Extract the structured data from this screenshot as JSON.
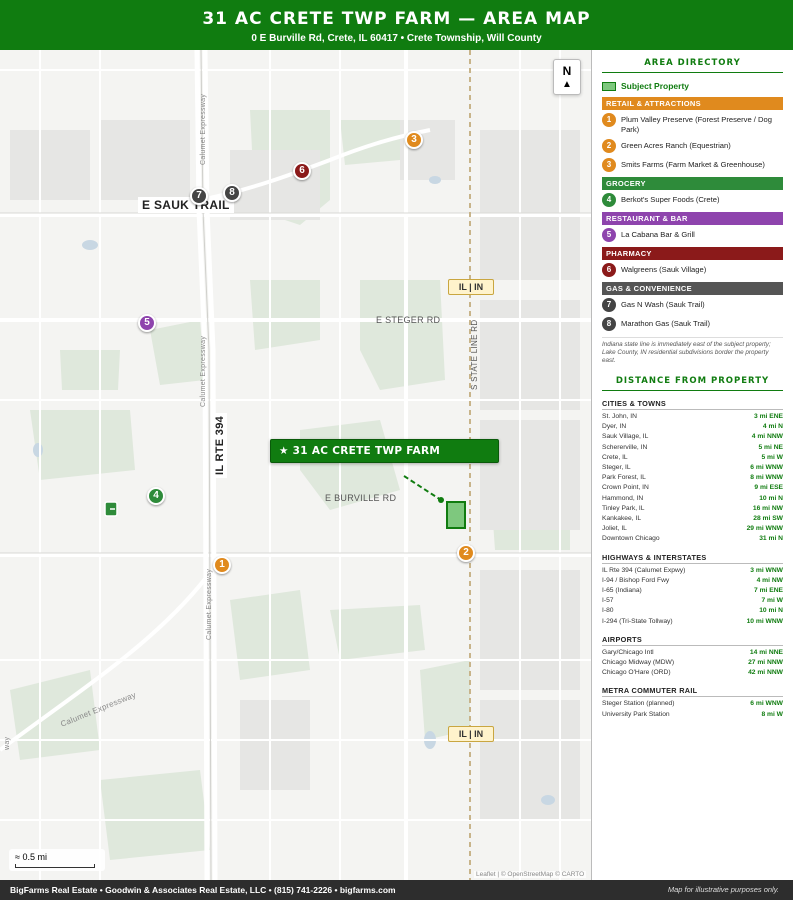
{
  "header": {
    "title": "31 AC CRETE TWP FARM — AREA MAP",
    "subtitle": "0 E Burville Rd, Crete, IL 60417 • Crete Township, Will County"
  },
  "map": {
    "compass": "N",
    "farm_label": "★ 31 AC CRETE TWP FARM",
    "road_labels": {
      "sauk_trail": "E SAUK TRAIL",
      "steger_rd": "E STEGER RD",
      "burville_rd": "E BURVILLE RD",
      "il_rte_394": "IL RTE 394",
      "state_line_rd": "S STATE LINE RD",
      "calumet_expy_1": "Calumet Expressway",
      "calumet_expy_2": "Calumet Expressway",
      "calumet_expy_3": "Calumet Expressway",
      "calumet_expy_diag": "Calumet Expressway",
      "expy_edge": "way"
    },
    "state_line_badge": "IL | IN",
    "markers": {
      "m1": "1",
      "m2": "2",
      "m3": "3",
      "m4": "4",
      "m5": "5",
      "m6": "6",
      "m7": "7",
      "m8": "8"
    },
    "scale": "≈ 0.5 mi",
    "attribution": "Leaflet | © OpenStreetMap © CARTO"
  },
  "sidebar": {
    "directory_title": "AREA DIRECTORY",
    "subject_label": "Subject Property",
    "categories": {
      "retail": "RETAIL & ATTRACTIONS",
      "grocery": "GROCERY",
      "restaurant": "RESTAURANT & BAR",
      "pharmacy": "PHARMACY",
      "gas": "GAS & CONVENIENCE"
    },
    "entries": {
      "e1": {
        "num": "1",
        "name": "Plum Valley Preserve (Forest Preserve / Dog Park)"
      },
      "e2": {
        "num": "2",
        "name": "Green Acres Ranch (Equestrian)"
      },
      "e3": {
        "num": "3",
        "name": "Smits Farms (Farm Market & Greenhouse)"
      },
      "e4": {
        "num": "4",
        "name": "Berkot's Super Foods (Crete)"
      },
      "e5": {
        "num": "5",
        "name": "La Cabana Bar & Grill"
      },
      "e6": {
        "num": "6",
        "name": "Walgreens (Sauk Village)"
      },
      "e7": {
        "num": "7",
        "name": "Gas N Wash (Sauk Trail)"
      },
      "e8": {
        "num": "8",
        "name": "Marathon Gas (Sauk Trail)"
      }
    },
    "note": "Indiana state line is immediately east of the subject property; Lake County, IN residential subdivisions border the property east.",
    "distance_title": "DISTANCE FROM PROPERTY",
    "groups": {
      "cities": {
        "title": "CITIES & TOWNS",
        "rows": [
          {
            "name": "St. John, IN",
            "dist": "3 mi ENE"
          },
          {
            "name": "Dyer, IN",
            "dist": "4 mi N"
          },
          {
            "name": "Sauk Village, IL",
            "dist": "4 mi NNW"
          },
          {
            "name": "Schererville, IN",
            "dist": "5 mi NE"
          },
          {
            "name": "Crete, IL",
            "dist": "5 mi W"
          },
          {
            "name": "Steger, IL",
            "dist": "6 mi WNW"
          },
          {
            "name": "Park Forest, IL",
            "dist": "8 mi WNW"
          },
          {
            "name": "Crown Point, IN",
            "dist": "9 mi ESE"
          },
          {
            "name": "Hammond, IN",
            "dist": "10 mi N"
          },
          {
            "name": "Tinley Park, IL",
            "dist": "16 mi NW"
          },
          {
            "name": "Kankakee, IL",
            "dist": "28 mi SW"
          },
          {
            "name": "Joliet, IL",
            "dist": "29 mi WNW"
          },
          {
            "name": "Downtown Chicago",
            "dist": "31 mi N"
          }
        ]
      },
      "highways": {
        "title": "HIGHWAYS & INTERSTATES",
        "rows": [
          {
            "name": "IL Rte 394 (Calumet Expwy)",
            "dist": "3 mi WNW"
          },
          {
            "name": "I-94 / Bishop Ford Fwy",
            "dist": "4 mi NW"
          },
          {
            "name": "I-65 (Indiana)",
            "dist": "7 mi ENE"
          },
          {
            "name": "I-57",
            "dist": "7 mi W"
          },
          {
            "name": "I-80",
            "dist": "10 mi N"
          },
          {
            "name": "I-294 (Tri-State Tollway)",
            "dist": "10 mi WNW"
          }
        ]
      },
      "airports": {
        "title": "AIRPORTS",
        "rows": [
          {
            "name": "Gary/Chicago Intl",
            "dist": "14 mi NNE"
          },
          {
            "name": "Chicago Midway (MDW)",
            "dist": "27 mi NNW"
          },
          {
            "name": "Chicago O'Hare (ORD)",
            "dist": "42 mi NNW"
          }
        ]
      },
      "metra": {
        "title": "METRA COMMUTER RAIL",
        "rows": [
          {
            "name": "Steger Station (planned)",
            "dist": "6 mi WNW"
          },
          {
            "name": "University Park Station",
            "dist": "8 mi W"
          }
        ]
      }
    }
  },
  "footer": {
    "left": "BigFarms Real Estate • Goodwin & Associates Real Estate, LLC • (815) 741-2226 • bigfarms.com",
    "right": "Map for illustrative purposes only."
  },
  "colors": {
    "brand_green": "#107c10",
    "retail_orange": "#e08a1e",
    "grocery_green": "#2e8b3a",
    "restaurant_purple": "#8e44ad",
    "pharmacy_red": "#8b1a1a",
    "gas_gray": "#555555"
  }
}
